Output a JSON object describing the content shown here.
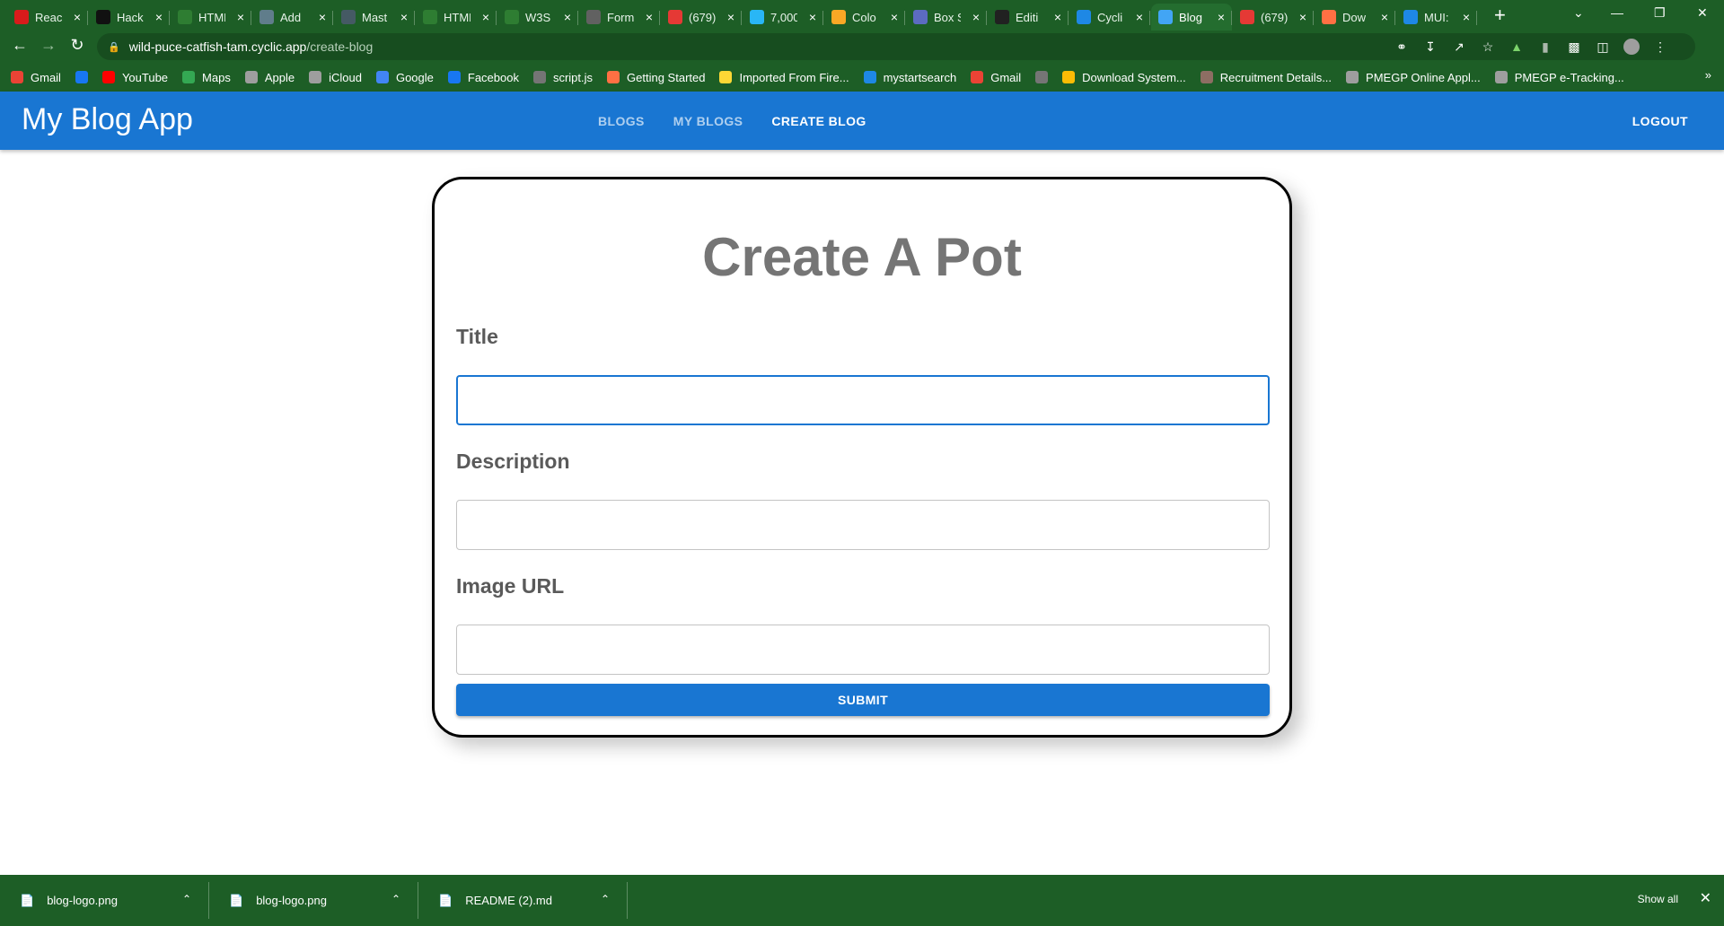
{
  "browser": {
    "tabs": [
      {
        "title": "React",
        "icon_color": "#d81b1b",
        "icon": "react-tab-icon"
      },
      {
        "title": "Hack",
        "icon_color": "#111111",
        "icon": "hackerrank-tab-icon"
      },
      {
        "title": "HTML",
        "icon_color": "#2e7d32",
        "icon": "w3-tab-icon"
      },
      {
        "title": "Add",
        "icon_color": "#607d8b",
        "icon": "openai-tab-icon"
      },
      {
        "title": "Mast",
        "icon_color": "#455a64",
        "icon": "link-tab-icon"
      },
      {
        "title": "HTML",
        "icon_color": "#2e7d32",
        "icon": "w3-tab-icon"
      },
      {
        "title": "W3S",
        "icon_color": "#2e7d32",
        "icon": "w3-tab-icon"
      },
      {
        "title": "Form",
        "icon_color": "#616161",
        "icon": "globe-tab-icon"
      },
      {
        "title": "(679)",
        "icon_color": "#e53935",
        "icon": "youtube-tab-icon"
      },
      {
        "title": "7,000",
        "icon_color": "#29b6f6",
        "icon": "search-tab-icon"
      },
      {
        "title": "Colo",
        "icon_color": "#f9a825",
        "icon": "palette-tab-icon"
      },
      {
        "title": "Box S",
        "icon_color": "#5c6bc0",
        "icon": "box-tab-icon"
      },
      {
        "title": "Editi",
        "icon_color": "#212121",
        "icon": "github-tab-icon"
      },
      {
        "title": "Cycli",
        "icon_color": "#1e88e5",
        "icon": "cyclic-tab-icon"
      },
      {
        "title": "Blog",
        "icon_color": "#42a5f5",
        "icon": "react-tab-icon"
      },
      {
        "title": "(679)",
        "icon_color": "#e53935",
        "icon": "youtube-tab-icon"
      },
      {
        "title": "Dow",
        "icon_color": "#ff7043",
        "icon": "download-tab-icon"
      },
      {
        "title": "MUI:",
        "icon_color": "#1e88e5",
        "icon": "mui-tab-icon"
      }
    ],
    "active_tab_index": 14,
    "url_host": "wild-puce-catfish-tam.cyclic.app",
    "url_path": "/create-blog",
    "bookmarks": [
      {
        "label": "Gmail",
        "color": "#ea4335"
      },
      {
        "label": "",
        "color": "#1877f2"
      },
      {
        "label": "YouTube",
        "color": "#ff0000"
      },
      {
        "label": "Maps",
        "color": "#34a853"
      },
      {
        "label": "Apple",
        "color": "#9e9e9e"
      },
      {
        "label": "iCloud",
        "color": "#9e9e9e"
      },
      {
        "label": "Google",
        "color": "#4285f4"
      },
      {
        "label": "Facebook",
        "color": "#1877f2"
      },
      {
        "label": "script.js",
        "color": "#757575"
      },
      {
        "label": "Getting Started",
        "color": "#ff7043"
      },
      {
        "label": "Imported From Fire...",
        "color": "#fdd835"
      },
      {
        "label": "mystartsearch",
        "color": "#1e88e5"
      },
      {
        "label": "Gmail",
        "color": "#ea4335"
      },
      {
        "label": "",
        "color": "#757575"
      },
      {
        "label": "Download System...",
        "color": "#fbbc05"
      },
      {
        "label": "Recruitment Details...",
        "color": "#8d6e63"
      },
      {
        "label": "PMEGP Online Appl...",
        "color": "#9e9e9e"
      },
      {
        "label": "PMEGP e-Tracking...",
        "color": "#9e9e9e"
      }
    ]
  },
  "app": {
    "brand": "My Blog App",
    "nav": [
      {
        "label": "BLOGS",
        "active": false
      },
      {
        "label": "MY BLOGS",
        "active": false
      },
      {
        "label": "CREATE BLOG",
        "active": true
      }
    ],
    "logout_label": "LOGOUT"
  },
  "form": {
    "heading": "Create A Pot",
    "fields": [
      {
        "label": "Title",
        "value": "",
        "focused": true
      },
      {
        "label": "Description",
        "value": "",
        "focused": false
      },
      {
        "label": "Image URL",
        "value": "",
        "focused": false
      }
    ],
    "submit_label": "SUBMIT"
  },
  "downloads": {
    "items": [
      {
        "filename": "blog-logo.png"
      },
      {
        "filename": "blog-logo.png"
      },
      {
        "filename": "README (2).md"
      }
    ],
    "show_all_label": "Show all"
  }
}
